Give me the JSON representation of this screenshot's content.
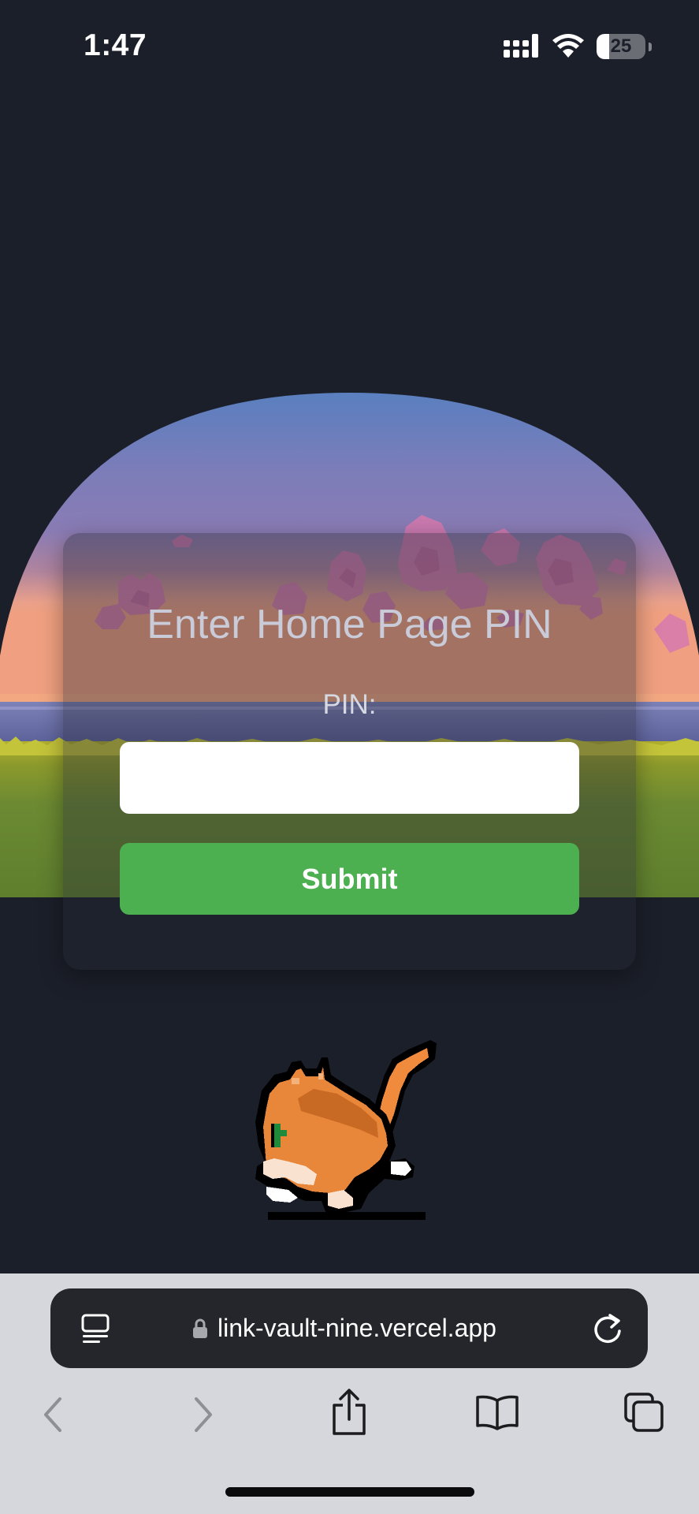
{
  "status_bar": {
    "time": "1:47",
    "battery_level": "25",
    "battery_fraction": 0.25,
    "signal_icon": "cellular-signal-icon",
    "wifi_icon": "wifi-icon"
  },
  "pin_form": {
    "title": "Enter Home Page PIN",
    "pin_label": "PIN:",
    "pin_value": "",
    "pin_placeholder": "",
    "submit_label": "Submit"
  },
  "browser": {
    "url": "link-vault-nine.vercel.app",
    "reader_icon": "page-menu-icon",
    "lock_icon": "lock-icon",
    "reload_icon": "reload-icon",
    "toolbar": [
      "back-icon",
      "forward-icon",
      "share-icon",
      "bookmarks-icon",
      "tabs-icon"
    ]
  },
  "colors": {
    "page_background": "#1b1f29",
    "title_text": "#c9ccd8",
    "input_background": "#ffffff",
    "submit_background": "#4caf50",
    "submit_text": "#ffffff",
    "browser_chrome": "#d5d7dc",
    "url_bar": "#25262b"
  }
}
